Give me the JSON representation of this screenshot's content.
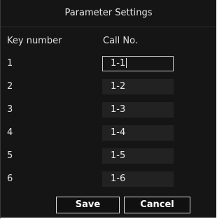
{
  "dialog": {
    "title": "Parameter Settings"
  },
  "columns": {
    "key_number": "Key number",
    "call_no": "Call No."
  },
  "rows": [
    {
      "key": "1",
      "call_no": "1-1",
      "focused": true
    },
    {
      "key": "2",
      "call_no": "1-2",
      "focused": false
    },
    {
      "key": "3",
      "call_no": "1-3",
      "focused": false
    },
    {
      "key": "4",
      "call_no": "1-4",
      "focused": false
    },
    {
      "key": "5",
      "call_no": "1-5",
      "focused": false
    },
    {
      "key": "6",
      "call_no": "1-6",
      "focused": false
    }
  ],
  "buttons": {
    "save": "Save",
    "cancel": "Cancel"
  },
  "colors": {
    "background": "#151515",
    "field_background": "#222222",
    "text": "#e0e0e0",
    "focus_border": "#c9c9c9"
  }
}
